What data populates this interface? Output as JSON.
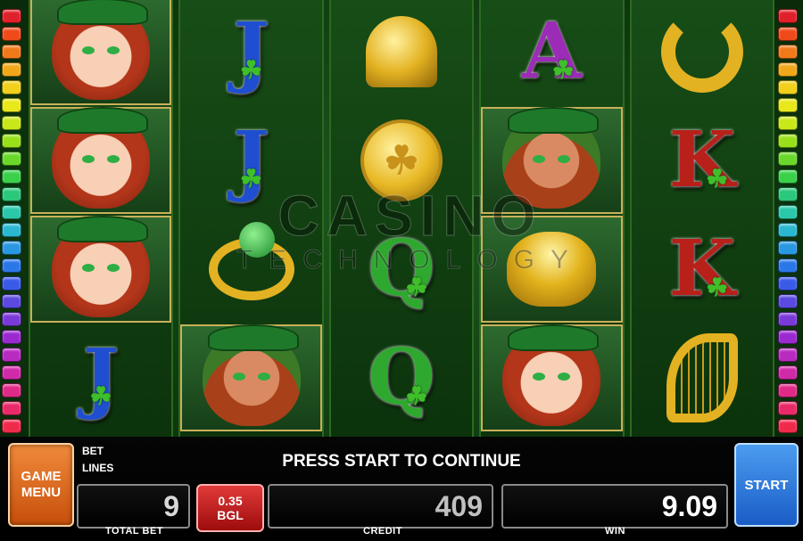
{
  "game": {
    "watermark": {
      "line1": "CASINO",
      "line2": "TECHNOLOGY"
    },
    "status_message": "PRESS START TO CONTINUE"
  },
  "reels": [
    [
      {
        "symbol": "redhead-girl"
      },
      {
        "symbol": "redhead-girl"
      },
      {
        "symbol": "redhead-girl"
      },
      {
        "symbol": "letter",
        "letter": "J",
        "color": "#1f4fd0"
      }
    ],
    [
      {
        "symbol": "letter",
        "letter": "J",
        "color": "#1f4fd0"
      },
      {
        "symbol": "letter",
        "letter": "J",
        "color": "#1f4fd0"
      },
      {
        "symbol": "ring"
      },
      {
        "symbol": "leprechaun"
      }
    ],
    [
      {
        "symbol": "bell"
      },
      {
        "symbol": "coin"
      },
      {
        "symbol": "letter",
        "letter": "Q",
        "color": "#2fa82f"
      },
      {
        "symbol": "letter",
        "letter": "Q",
        "color": "#2fa82f"
      }
    ],
    [
      {
        "symbol": "letter",
        "letter": "A",
        "color": "#9c2bb8"
      },
      {
        "symbol": "leprechaun"
      },
      {
        "symbol": "pot-of-gold"
      },
      {
        "symbol": "redhead-girl"
      }
    ],
    [
      {
        "symbol": "horseshoe"
      },
      {
        "symbol": "letter",
        "letter": "K",
        "color": "#b8201a"
      },
      {
        "symbol": "letter",
        "letter": "K",
        "color": "#b8201a"
      },
      {
        "symbol": "harp"
      }
    ]
  ],
  "marker_colors": [
    "#e0202a",
    "#f04a1a",
    "#f07a1a",
    "#f0a81a",
    "#f0d01a",
    "#e8e81a",
    "#c8e81a",
    "#98e01a",
    "#6ad82a",
    "#3ad04a",
    "#2ac87a",
    "#2ac8a8",
    "#2ab8d0",
    "#2a98e0",
    "#2a78e8",
    "#3a5ae8",
    "#5a4ae0",
    "#7a3ad8",
    "#9a2ad0",
    "#b82ac0",
    "#d02aa8",
    "#e02a88",
    "#e82a68",
    "#f02a4a"
  ],
  "panel": {
    "game_menu_label": "GAME\nMENU",
    "bet_label": "BET",
    "lines_label": "LINES",
    "total_bet_value": "9",
    "total_bet_caption": "TOTAL BET",
    "denomination": {
      "value": "0.35",
      "currency": "BGL"
    },
    "credit_value": "409",
    "credit_caption": "CREDIT",
    "win_value": "9.09",
    "win_caption": "WIN",
    "start_label": "START"
  },
  "colors": {
    "game_menu": "#e06a1e",
    "start": "#2d7ae0",
    "denomination": "#c41f1f"
  }
}
